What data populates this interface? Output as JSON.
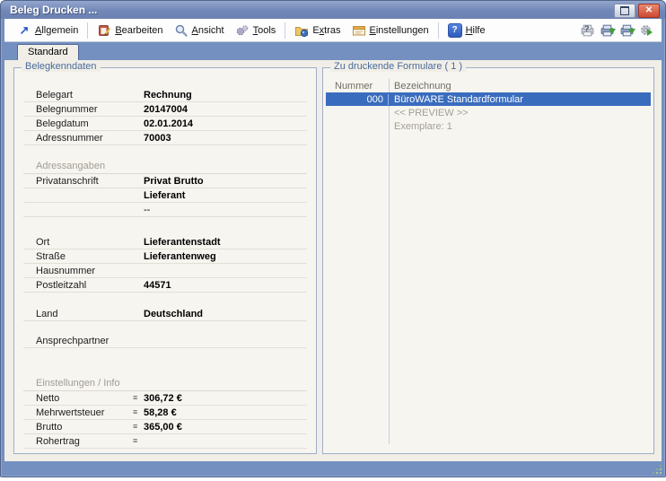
{
  "window": {
    "title": "Beleg Drucken ..."
  },
  "icons": {
    "close": "✕",
    "allgemein_arrow": "↗",
    "help_question": "?",
    "value_marker": "≡"
  },
  "menu": {
    "items": [
      {
        "pre": "",
        "u": "A",
        "post": "llgemein"
      },
      {
        "pre": "",
        "u": "B",
        "post": "earbeiten"
      },
      {
        "pre": "",
        "u": "A",
        "post": "nsicht"
      },
      {
        "pre": "",
        "u": "T",
        "post": "ools"
      },
      {
        "pre": "E",
        "u": "x",
        "post": "tras"
      },
      {
        "pre": "",
        "u": "E",
        "post": "instellungen"
      },
      {
        "pre": "",
        "u": "H",
        "post": "ilfe"
      }
    ]
  },
  "tab": {
    "label": "Standard"
  },
  "left_panel": {
    "title": "Belegkenndaten",
    "rows": [
      {
        "t": "field",
        "label": "Belegart",
        "value": "Rechnung"
      },
      {
        "t": "field",
        "label": "Belegnummer",
        "value": "20147004"
      },
      {
        "t": "field",
        "label": "Belegdatum",
        "value": "02.01.2014"
      },
      {
        "t": "field",
        "label": "Adressnummer",
        "value": "70003"
      },
      {
        "t": "gap",
        "h": 16
      },
      {
        "t": "section",
        "label": "Adressangaben"
      },
      {
        "t": "field",
        "label": "Privatanschrift",
        "value": "Privat Brutto"
      },
      {
        "t": "field",
        "label": "",
        "value": "Lieferant"
      },
      {
        "t": "field",
        "label": "",
        "value": "--",
        "normal": true
      },
      {
        "t": "gap",
        "h": 20
      },
      {
        "t": "field",
        "label": "Ort",
        "value": "Lieferantenstadt"
      },
      {
        "t": "field",
        "label": "Straße",
        "value": "Lieferantenweg"
      },
      {
        "t": "field",
        "label": "Hausnummer",
        "value": ""
      },
      {
        "t": "field",
        "label": "Postleitzahl",
        "value": "44571"
      },
      {
        "t": "gap",
        "h": 16
      },
      {
        "t": "field",
        "label": "Land",
        "value": "Deutschland"
      },
      {
        "t": "gap",
        "h": 14
      },
      {
        "t": "field",
        "label": "Ansprechpartner",
        "value": ""
      },
      {
        "t": "gap",
        "h": 32
      },
      {
        "t": "section",
        "label": "Einstellungen / Info"
      },
      {
        "t": "field",
        "label": "Netto",
        "value": "306,72 €",
        "marker": true
      },
      {
        "t": "field",
        "label": "Mehrwertsteuer",
        "value": "58,28 €",
        "marker": true
      },
      {
        "t": "field",
        "label": "Brutto",
        "value": "365,00 €",
        "marker": true
      },
      {
        "t": "field",
        "label": "Rohertrag",
        "value": "",
        "marker": true
      }
    ]
  },
  "right_panel": {
    "title": "Zu druckende Formulare ( 1 )",
    "columns": [
      "Nummer",
      "Bezeichnung"
    ],
    "rows": [
      {
        "nummer": "000",
        "bezeichnung": "BüroWARE Standardformular",
        "selected": true
      },
      {
        "nummer": "",
        "bezeichnung": "<< PREVIEW >>",
        "muted": true
      },
      {
        "nummer": "",
        "bezeichnung": "Exemplare: 1",
        "muted": true
      }
    ]
  },
  "colors": {
    "titlebar_blue": "#7187b7",
    "frame_blue": "#7390c0",
    "content_bg": "#f1eee7",
    "selected_row": "#3a6cbe",
    "group_title": "#4a6b9b"
  }
}
